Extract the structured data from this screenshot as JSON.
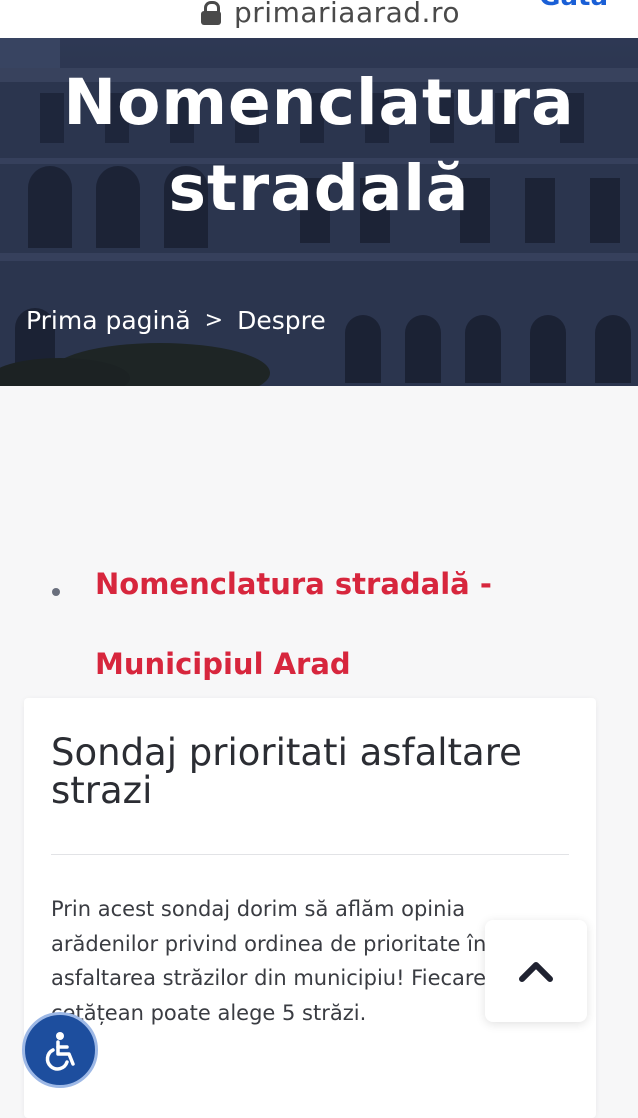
{
  "browser": {
    "url": "primariaarad.ro",
    "action_label": "Gata"
  },
  "hero": {
    "title_line1": "Nomenclatura",
    "title_line2": "stradală",
    "breadcrumb": {
      "home": "Prima pagină",
      "separator": ">",
      "current": "Despre"
    }
  },
  "content": {
    "list_item_line1": "Nomenclatura stradală -",
    "list_item_line2": "Municipiul Arad",
    "card": {
      "title": "Sondaj prioritati asfaltare strazi",
      "text": "Prin acest sondaj dorim să aflăm opinia arădenilor privind ordinea de prioritate în asfaltarea străzilor din municipiu! Fiecare cetățean poate alege 5 străzi."
    }
  },
  "icons": {
    "lock": "lock-icon",
    "scroll_top": "chevron-up-icon",
    "accessibility": "wheelchair-icon"
  },
  "colors": {
    "link_red": "#d7263d",
    "accent_blue": "#1d4e9e",
    "hero_dark": "#2d3854"
  }
}
